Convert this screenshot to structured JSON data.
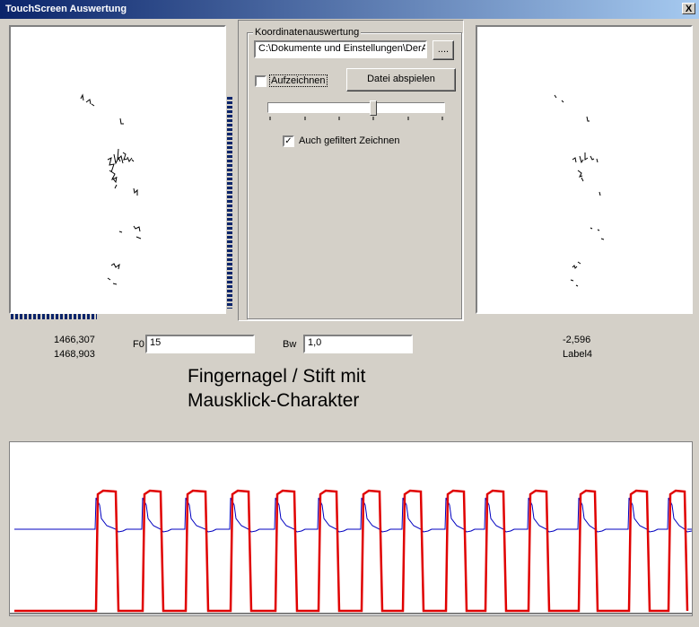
{
  "window": {
    "title": "TouchScreen Auswertung",
    "close_label": "X"
  },
  "koordinaten": {
    "group_label": "Koordinatenauswertung",
    "path_value": "C:\\Dokumente und Einstellungen\\DerA",
    "browse_label": "....",
    "record_label": "Aufzeichnen",
    "record_checked": false,
    "play_label": "Datei abspielen",
    "slider_fraction": 0.6,
    "filter_label": "Auch gefiltert Zeichnen",
    "filter_checked": true
  },
  "readout": {
    "coord_a": "1466,307",
    "coord_b": "1468,903",
    "f0_label": "F0",
    "f0_value": "15",
    "bw_label": "Bw",
    "bw_value": "1,0",
    "value_right": "-2,596",
    "label4": "Label4"
  },
  "caption": {
    "line1": "Fingernagel / Stift mit",
    "line2": "Mausklick-Charakter"
  },
  "progress": {
    "vertical_fraction": 0.74,
    "horizontal_fraction": 0.4
  },
  "colors": {
    "titlebar_start": "#0a246a",
    "titlebar_end": "#a6caf0",
    "signal_red": "#e00000",
    "signal_blue": "#0000c0",
    "progress_blue": "#0a246a"
  },
  "icons": {
    "close": "close-icon",
    "check": "check-icon"
  }
}
